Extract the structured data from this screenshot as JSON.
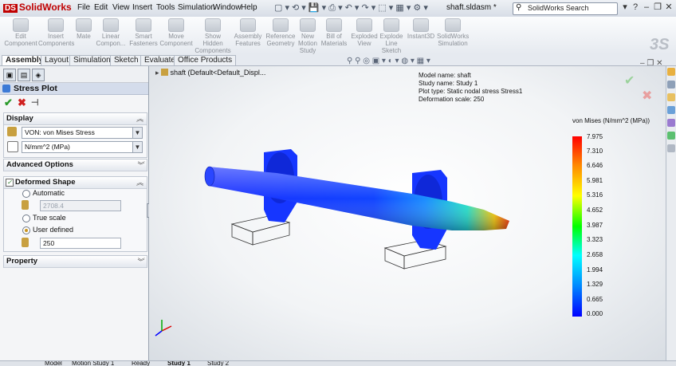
{
  "app": {
    "name": "SolidWorks",
    "document_title": "shaft.sldasm *",
    "menu": [
      "File",
      "Edit",
      "View",
      "Insert",
      "Tools",
      "Simulation",
      "Window",
      "Help"
    ],
    "search_placeholder": "SolidWorks Search",
    "brand_watermark": "3S"
  },
  "toolbar": [
    {
      "label": "Edit Component",
      "icon": "edit-component-icon"
    },
    {
      "label": "Insert Components",
      "icon": "insert-components-icon"
    },
    {
      "label": "Mate",
      "icon": "mate-icon"
    },
    {
      "label": "Linear Compon...",
      "icon": "linear-pattern-icon"
    },
    {
      "label": "Smart Fasteners",
      "icon": "smart-fasteners-icon"
    },
    {
      "label": "Move Component",
      "icon": "move-component-icon"
    },
    {
      "label": "Show Hidden Components",
      "icon": "show-hidden-icon"
    },
    {
      "label": "Assembly Features",
      "icon": "assembly-features-icon"
    },
    {
      "label": "Reference Geometry",
      "icon": "reference-geometry-icon"
    },
    {
      "label": "New Motion Study",
      "icon": "motion-study-icon"
    },
    {
      "label": "Bill of Materials",
      "icon": "bom-icon"
    },
    {
      "label": "Exploded View",
      "icon": "exploded-view-icon"
    },
    {
      "label": "Explode Line Sketch",
      "icon": "explode-line-icon"
    },
    {
      "label": "Instant3D",
      "icon": "instant3d-icon"
    },
    {
      "label": "SolidWorks Simulation",
      "icon": "simulation-icon"
    }
  ],
  "tabs": [
    "Assembly",
    "Layout",
    "Simulation",
    "Sketch",
    "Evaluate",
    "Office Products"
  ],
  "active_tab": "Assembly",
  "property_manager": {
    "title": "Stress Plot",
    "display": {
      "heading": "Display",
      "component": "VON: von Mises Stress",
      "units": "N/mm^2 (MPa)"
    },
    "advanced_heading": "Advanced Options",
    "deformed": {
      "heading": "Deformed Shape",
      "checked": true,
      "options": [
        "Automatic",
        "True scale",
        "User defined"
      ],
      "selected": "User defined",
      "automatic_value": "2708.4",
      "user_value": "250"
    },
    "property_heading": "Property"
  },
  "viewport": {
    "tree_label": "shaft  (Default<Default_Displ...",
    "info": [
      "Model name: shaft",
      "Study name: Study 1",
      "Plot type: Static nodal stress Stress1",
      "Deformation scale: 250"
    ],
    "legend": {
      "title": "von Mises (N/mm^2 (MPa))",
      "values": [
        "7.975",
        "7.310",
        "6.646",
        "5.981",
        "5.316",
        "4.652",
        "3.987",
        "3.323",
        "2.658",
        "1.994",
        "1.329",
        "0.665",
        "0.000"
      ],
      "gradient": [
        "#ff0000",
        "#ff8800",
        "#ffff00",
        "#00ff00",
        "#00ffff",
        "#0088ff",
        "#0000ff"
      ]
    }
  },
  "bottom_tabs": [
    "Model",
    "Motion Study 1",
    "Ready",
    "Study 1",
    "Study 2"
  ],
  "colors": {
    "title_red": "#c00000",
    "panel_header": "#d4dceb",
    "ok_green": "#2a9a2a",
    "cancel_red": "#d02020"
  }
}
